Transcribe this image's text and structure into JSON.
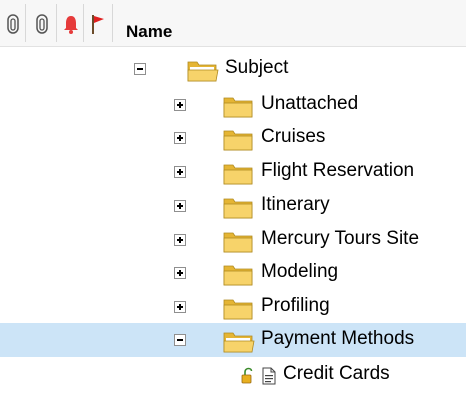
{
  "header": {
    "icons": [
      "attachment-icon",
      "attachment-icon",
      "alert-bell-icon",
      "flag-icon"
    ],
    "name_label": "Name"
  },
  "tree": {
    "root": {
      "label": "Subject",
      "expanded": true
    },
    "children": [
      {
        "label": "Unattached",
        "expanded": false
      },
      {
        "label": "Cruises",
        "expanded": false
      },
      {
        "label": "Flight Reservation",
        "expanded": false
      },
      {
        "label": "Itinerary",
        "expanded": false
      },
      {
        "label": "Mercury Tours Site",
        "expanded": false
      },
      {
        "label": "Modeling",
        "expanded": false
      },
      {
        "label": "Profiling",
        "expanded": false
      },
      {
        "label": "Payment Methods",
        "expanded": true,
        "selected": true
      }
    ],
    "leaf": {
      "label": "Credit Cards",
      "icons": [
        "unlocked-icon",
        "document-icon"
      ]
    }
  },
  "colors": {
    "selection": "#cce4f7",
    "folder": "#f2c94c",
    "header_bg": "#f7f7f7"
  }
}
